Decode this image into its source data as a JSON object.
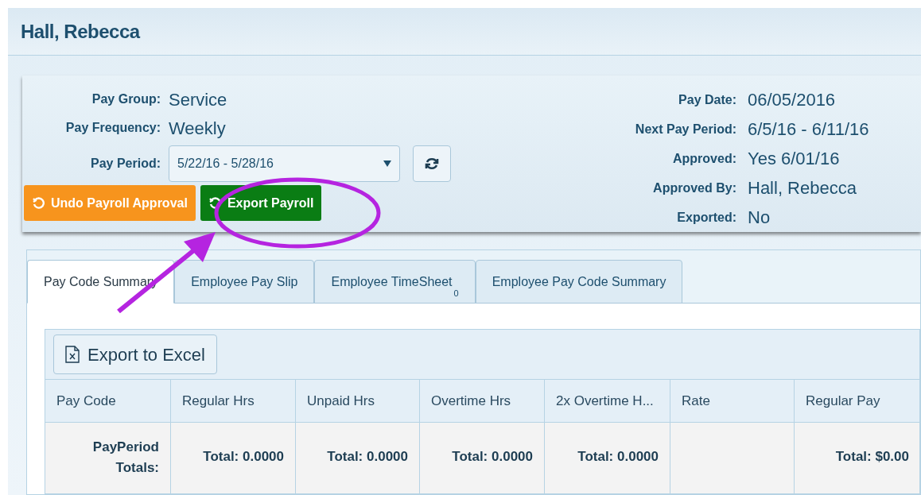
{
  "header": {
    "title": "Hall, Rebecca"
  },
  "left_fields": [
    {
      "label": "Pay Group:",
      "value": "Service",
      "kind": "text"
    },
    {
      "label": "Pay Frequency:",
      "value": "Weekly",
      "kind": "text"
    },
    {
      "label": "Pay Period:",
      "value": "5/22/16 - 5/28/16",
      "kind": "select"
    }
  ],
  "right_fields": [
    {
      "label": "Pay Date:",
      "value": "06/05/2016"
    },
    {
      "label": "Next Pay Period:",
      "value": "6/5/16 - 6/11/16"
    },
    {
      "label": "Approved:",
      "value": "Yes 6/01/16"
    },
    {
      "label": "Approved By:",
      "value": "Hall, Rebecca"
    },
    {
      "label": "Exported:",
      "value": "No"
    }
  ],
  "actions": [
    {
      "label": "Undo Payroll Approval",
      "color": "#f7941d"
    },
    {
      "label": "Export Payroll",
      "color": "#0a7d14"
    }
  ],
  "tabs": [
    {
      "label": "Pay Code Summary",
      "selected": true
    },
    {
      "label": "Employee Pay Slip",
      "selected": false
    },
    {
      "label": "Employee TimeSheet",
      "badge": "0",
      "selected": false
    },
    {
      "label": "Employee Pay Code Summary",
      "selected": false
    }
  ],
  "export_button": "Export to Excel",
  "table": {
    "columns": [
      "Pay Code",
      "Regular Hrs",
      "Unpaid Hrs",
      "Overtime Hrs",
      "2x Overtime H...",
      "Rate",
      "Regular Pay"
    ],
    "rows": [
      [
        "PayPeriod Totals:",
        "Total: 0.0000",
        "Total: 0.0000",
        "Total: 0.0000",
        "Total: 0.0000",
        "",
        "Total: $0.00"
      ]
    ]
  }
}
